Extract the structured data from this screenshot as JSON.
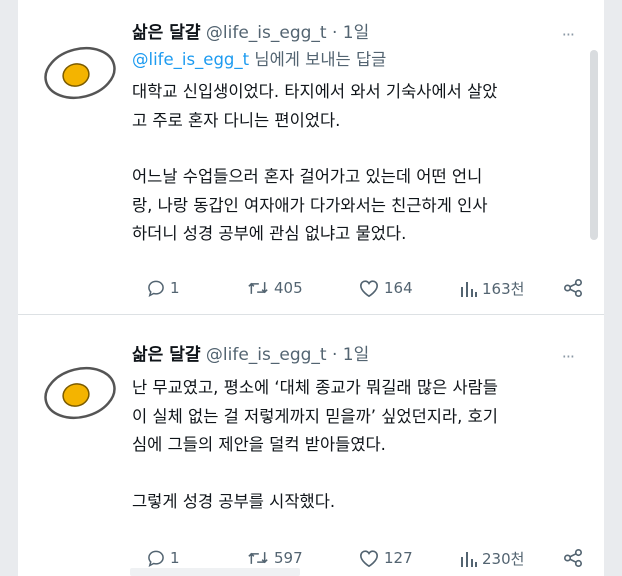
{
  "tweets": [
    {
      "display_name": "삶은 달걀",
      "handle": "@life_is_egg_t",
      "separator": "·",
      "time": "1일",
      "more_label": "···",
      "reply_to": {
        "mention": "@life_is_egg_t",
        "suffix": " 님에게 보내는 답글"
      },
      "lines": [
        [
          "대학교 신입생이었다. 타지에서 와서 기숙사에서 살았",
          "고 주로 혼자 다니는 편이었다."
        ],
        [
          "어느날 수업들으러 혼자 걸어가고 있는데 어떤 언니",
          "랑, 나랑 동갑인 여자애가 다가와서는 친근하게 인사",
          "하더니 성경 공부에 관심 없냐고 물었다."
        ]
      ],
      "stats": {
        "replies": "1",
        "retweets": "405",
        "likes": "164",
        "views": "163천"
      }
    },
    {
      "display_name": "삶은 달걀",
      "handle": "@life_is_egg_t",
      "separator": "·",
      "time": "1일",
      "more_label": "···",
      "lines": [
        [
          "난 무교였고, 평소에 ‘대체 종교가 뭐길래 많은 사람들",
          "이 실체 없는 걸 저렇게까지 믿을까’ 싶었던지라, 호기",
          "심에 그들의 제안을 덜컥 받아들였다."
        ],
        [
          "그렇게 성경 공부를 시작했다."
        ]
      ],
      "stats": {
        "replies": "1",
        "retweets": "597",
        "likes": "127",
        "views": "230천"
      }
    }
  ],
  "colors": {
    "accent": "#1d9bf0",
    "muted": "#536471",
    "text": "#0f1419",
    "yolk": "#f4b400"
  },
  "icons": [
    "egg-avatar-icon",
    "reply-icon",
    "retweet-icon",
    "like-icon",
    "views-icon",
    "share-icon",
    "more-icon"
  ]
}
